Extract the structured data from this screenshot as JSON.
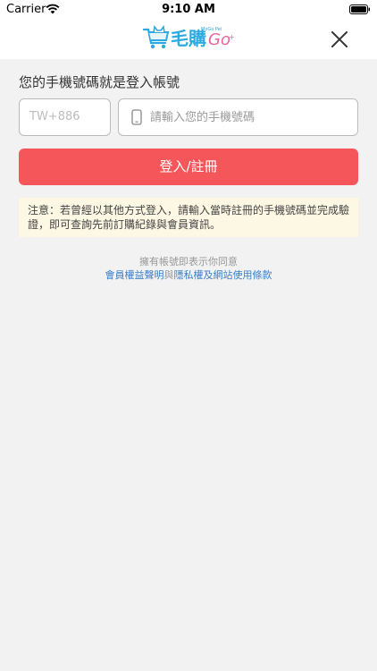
{
  "status_bar": {
    "carrier": "Carrier",
    "time": "9:10 AM"
  },
  "header": {
    "logo_text": "毛購Go",
    "logo_subtitle": "MoGo Pei"
  },
  "login": {
    "prompt": "您的手機號碼就是登入帳號",
    "country_code": "TW+886",
    "phone_placeholder": "請輸入您的手機號碼",
    "submit_label": "登入/註冊"
  },
  "notice": "注意：若曾經以其他方式登入，請輸入當時註冊的手機號碼並完成驗證，即可查詢先前訂購紀錄與會員資訊。",
  "terms": {
    "lead": "擁有帳號即表示你同意",
    "link_membership": "會員權益聲明",
    "connector": "與",
    "link_privacy": "隱私權及網站使用條款"
  },
  "colors": {
    "accent": "#f4565a",
    "link": "#3a7fc9",
    "notice_bg": "#fdf8e4"
  }
}
